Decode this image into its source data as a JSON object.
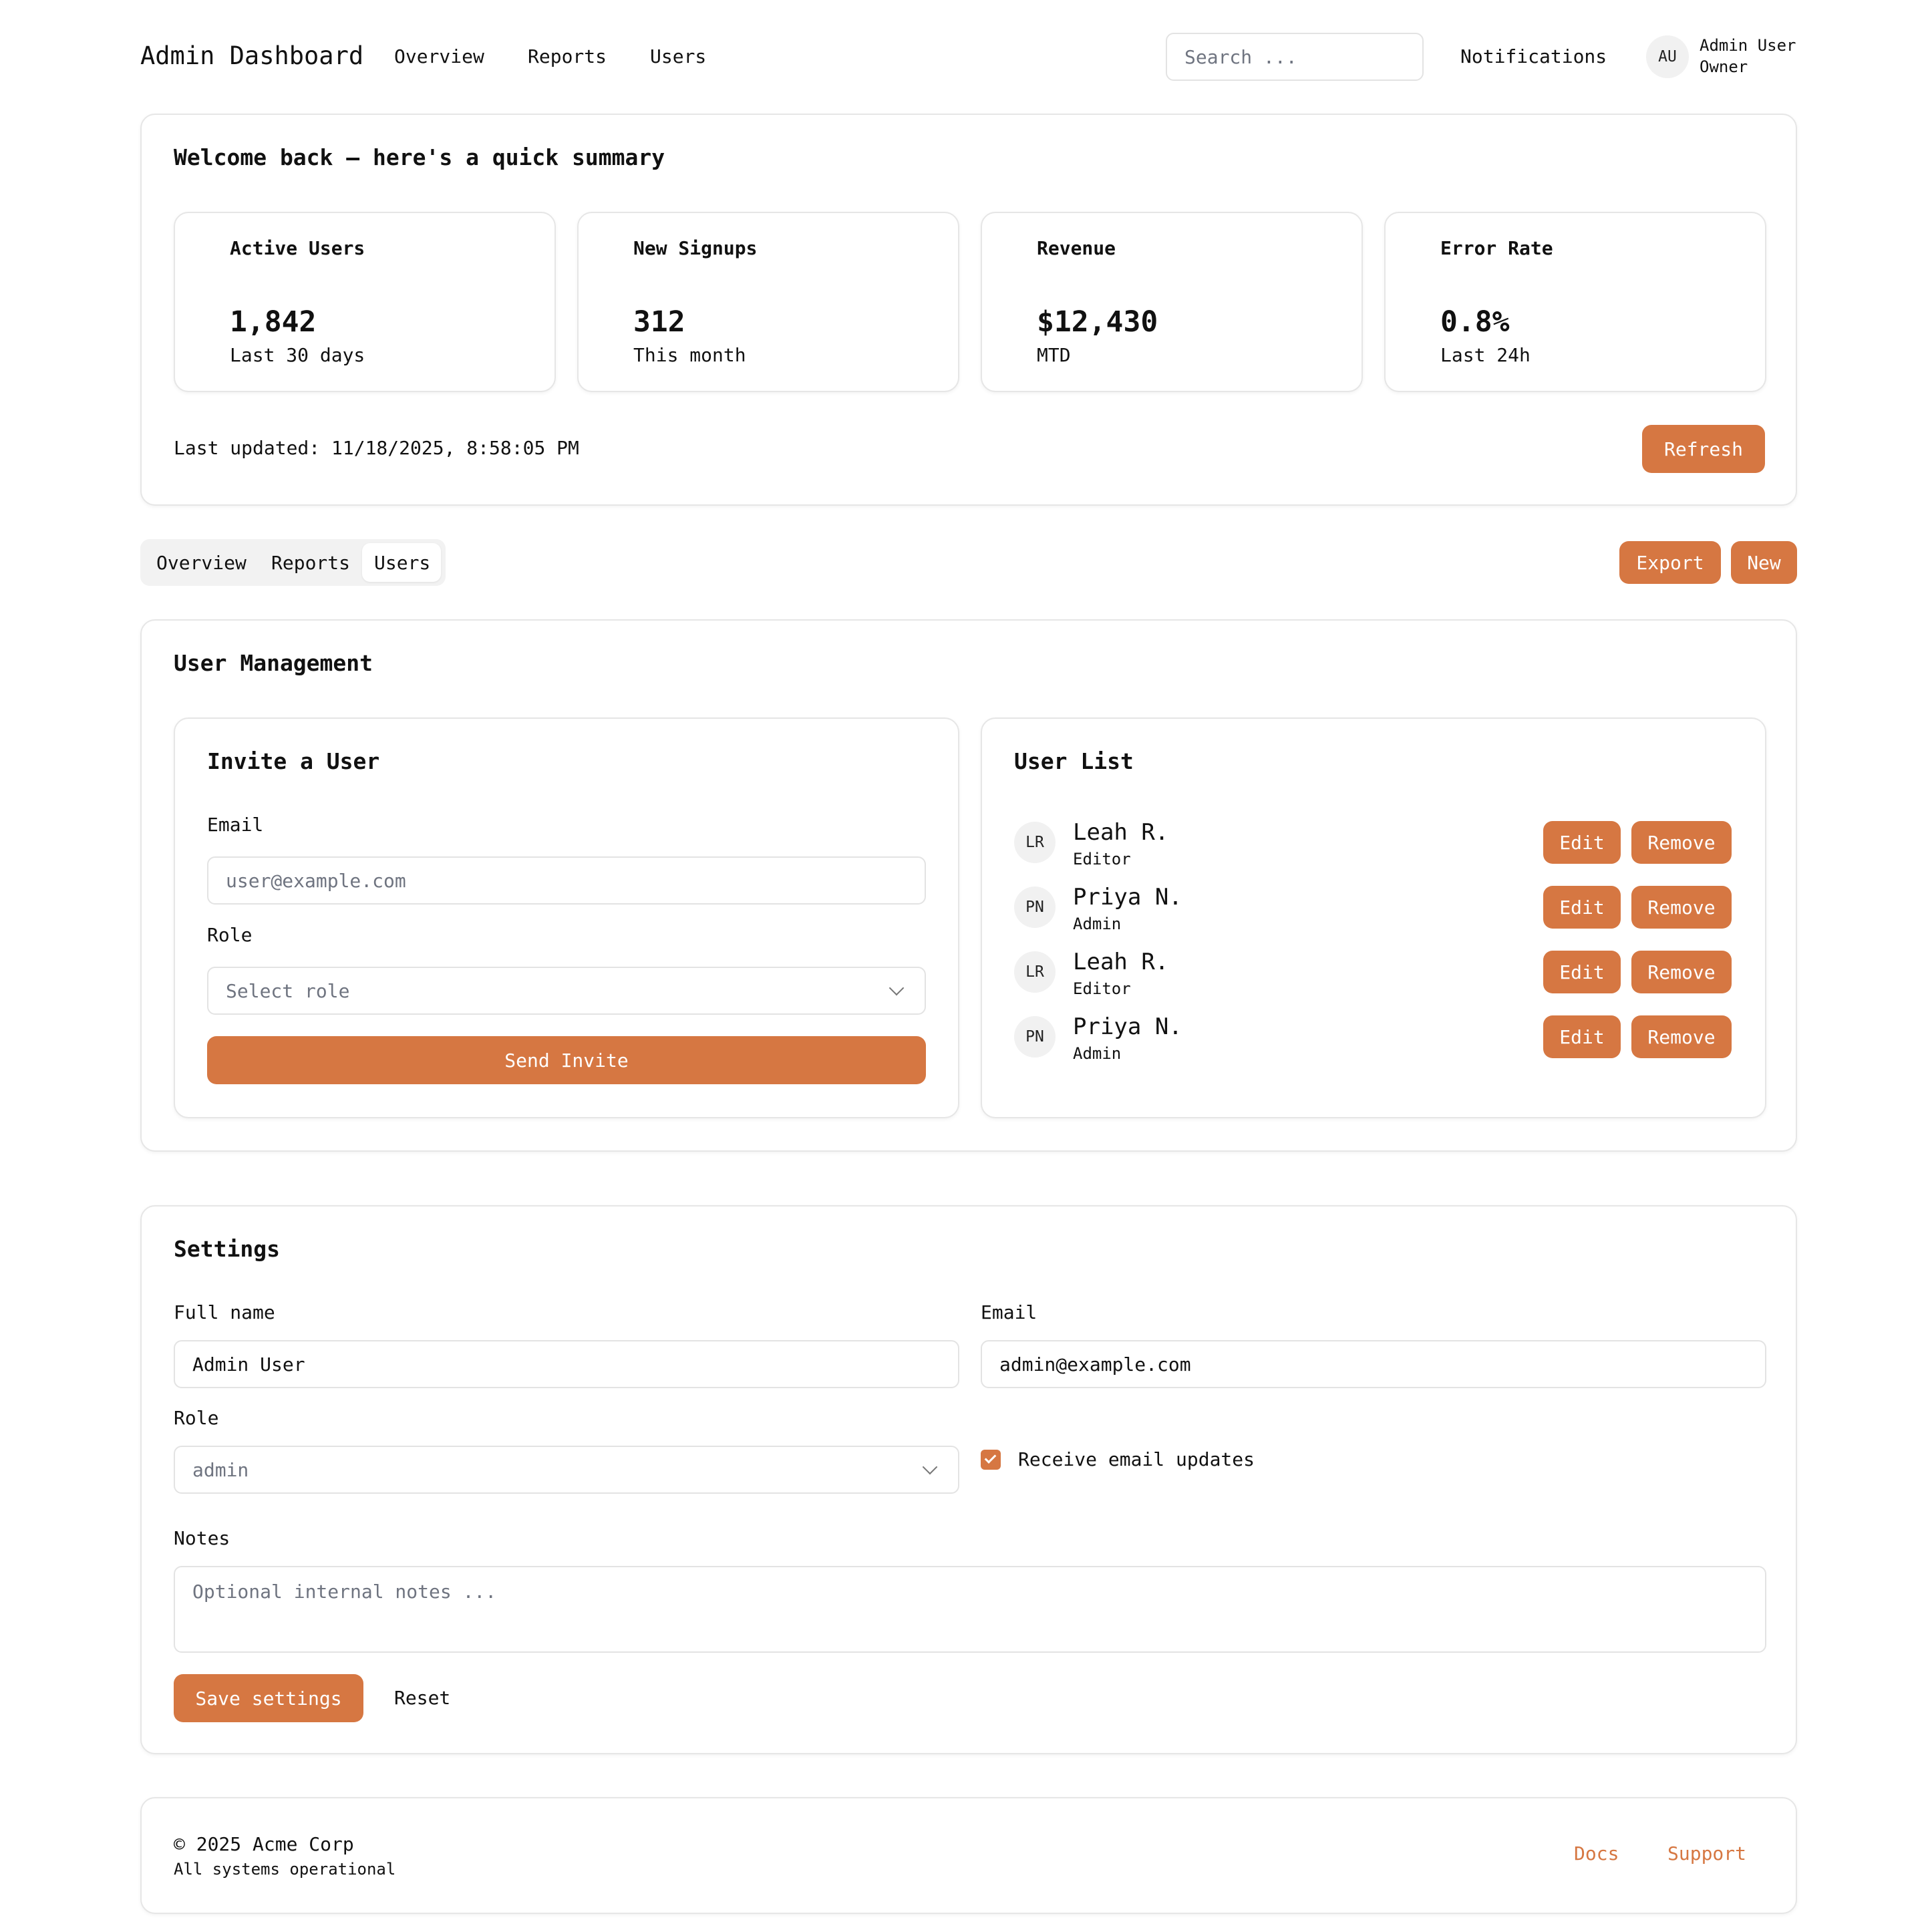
{
  "header": {
    "title": "Admin Dashboard",
    "nav": [
      "Overview",
      "Reports",
      "Users"
    ],
    "search_placeholder": "Search ...",
    "notifications": "Notifications",
    "avatar_initials": "AU",
    "user_name": "Admin User",
    "user_role": "Owner"
  },
  "summary": {
    "title": "Welcome back — here's a quick summary",
    "stats": [
      {
        "title": "Active Users",
        "value": "1,842",
        "sub": "Last 30 days"
      },
      {
        "title": "New Signups",
        "value": "312",
        "sub": "This month"
      },
      {
        "title": "Revenue",
        "value": "$12,430",
        "sub": "MTD"
      },
      {
        "title": "Error Rate",
        "value": "0.8%",
        "sub": "Last 24h"
      }
    ],
    "last_updated": "Last updated: 11/18/2025, 8:58:05 PM",
    "refresh_label": "Refresh"
  },
  "tabs": {
    "items": [
      "Overview",
      "Reports",
      "Users"
    ],
    "active": "Users",
    "export_label": "Export",
    "new_label": "New"
  },
  "user_management": {
    "title": "User Management",
    "invite": {
      "title": "Invite a User",
      "email_label": "Email",
      "email_placeholder": "user@example.com",
      "role_label": "Role",
      "role_placeholder": "Select role",
      "send_label": "Send Invite"
    },
    "list": {
      "title": "User List",
      "edit_label": "Edit",
      "remove_label": "Remove",
      "users": [
        {
          "initials": "LR",
          "name": "Leah R.",
          "role": "Editor"
        },
        {
          "initials": "PN",
          "name": "Priya N.",
          "role": "Admin"
        },
        {
          "initials": "LR",
          "name": "Leah R.",
          "role": "Editor"
        },
        {
          "initials": "PN",
          "name": "Priya N.",
          "role": "Admin"
        }
      ]
    }
  },
  "settings": {
    "title": "Settings",
    "full_name_label": "Full name",
    "full_name_value": "Admin User",
    "email_label": "Email",
    "email_value": "admin@example.com",
    "role_label": "Role",
    "role_value": "admin",
    "receive_updates_label": "Receive email updates",
    "receive_updates_checked": true,
    "notes_label": "Notes",
    "notes_placeholder": "Optional internal notes ...",
    "save_label": "Save settings",
    "reset_label": "Reset"
  },
  "footer": {
    "copyright": "© 2025 Acme Corp",
    "status": "All systems operational",
    "links": [
      "Docs",
      "Support"
    ]
  },
  "colors": {
    "accent": "#d67742",
    "border": "#e6e6e6",
    "text": "#111111",
    "placeholder": "#6f7480"
  }
}
